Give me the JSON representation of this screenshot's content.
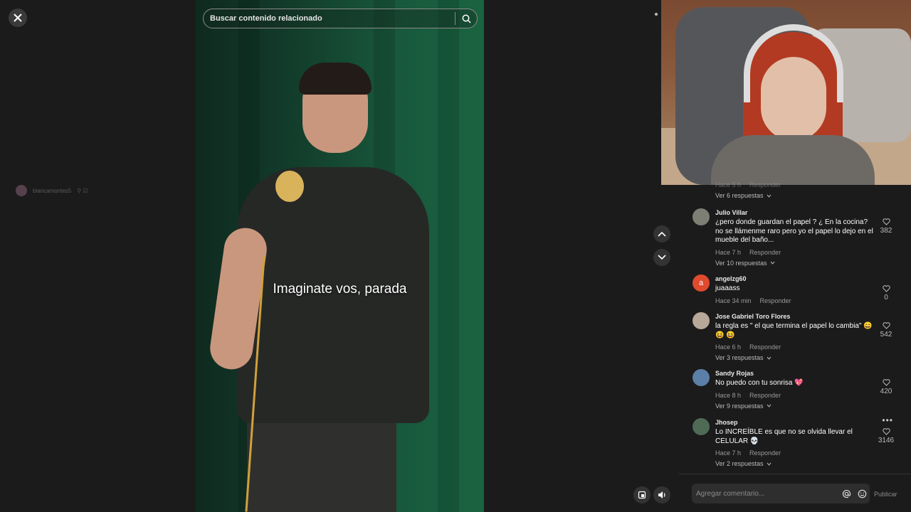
{
  "search": {
    "placeholder": "Buscar contenido relacionado"
  },
  "ghost_author": {
    "name": "biancamontes5"
  },
  "video": {
    "subtitle": "Imaginate vos, parada"
  },
  "comments": {
    "partial_top": {
      "time": "Hace 5 h",
      "reply": "Responder",
      "view_replies": "Ver 6 respuestas"
    },
    "items": [
      {
        "user": "Julio Villar",
        "text": "¿pero donde guardan el papel ? ¿ En la cocina? no se llámenme raro pero yo el papel lo dejo en el mueble del baño...",
        "time": "Hace 7 h",
        "reply": "Responder",
        "view_replies": "Ver 10 respuestas",
        "likes": "382",
        "avatar_color": "#7d7e74",
        "avatar_letter": ""
      },
      {
        "user": "angelzg60",
        "text": "juaaass",
        "time": "Hace 34 min",
        "reply": "Responder",
        "view_replies": "",
        "likes": "0",
        "avatar_color": "#e04a2f",
        "avatar_letter": "a"
      },
      {
        "user": "Jose Gabriel Toro Flores",
        "text": "la regla es \" el que termina el papel lo cambia\" 😄 😆 😆",
        "time": "Hace 6 h",
        "reply": "Responder",
        "view_replies": "Ver 3 respuestas",
        "likes": "542",
        "avatar_color": "#b7a89a",
        "avatar_letter": ""
      },
      {
        "user": "Sandy Rojas",
        "text": "No puedo con tu sonrisa 💖",
        "time": "Hace 8 h",
        "reply": "Responder",
        "view_replies": "Ver 9 respuestas",
        "likes": "420",
        "avatar_color": "#5b7fa6",
        "avatar_letter": ""
      },
      {
        "user": "Jhosep",
        "text": "Lo INCREÍBLE es que no se olvida llevar el CELULAR 💀",
        "time": "Hace 7 h",
        "reply": "Responder",
        "view_replies": "Ver 2 respuestas",
        "likes": "3146",
        "avatar_color": "#4f6a55",
        "avatar_letter": ""
      }
    ]
  },
  "comment_box": {
    "placeholder": "Agregar comentario...",
    "publish": "Publicar"
  }
}
